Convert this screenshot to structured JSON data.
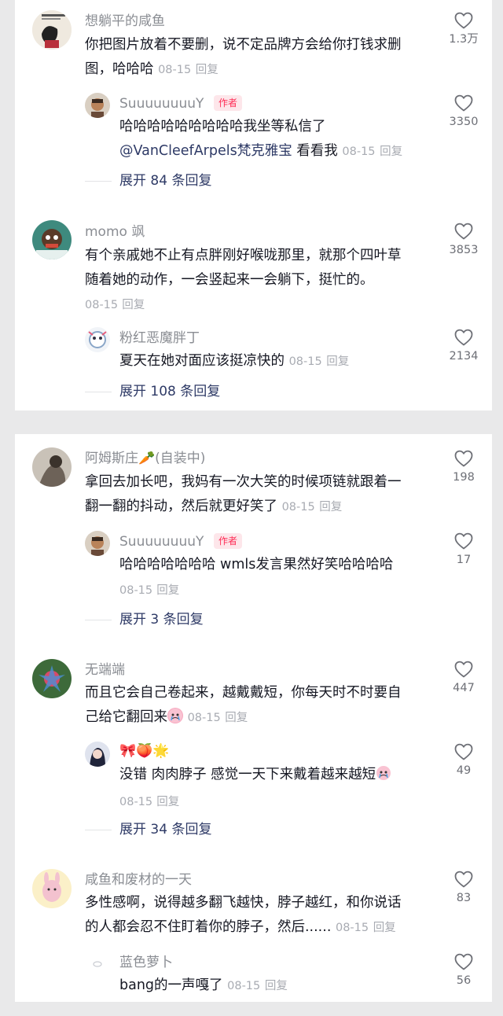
{
  "colors": {
    "author_tag": "#fe2c55",
    "link": "#2e3a66",
    "meta": "#a8abb2",
    "username": "#8a8d93",
    "body_text": "#161823"
  },
  "comments": [
    {
      "username": "想躺平的咸鱼",
      "text_lines": [
        "你把图片放着不要删，说不定品牌方会给你打钱求删",
        "图，哈哈哈"
      ],
      "date": "08-15",
      "reply_label": "回复",
      "likes": "1.3万",
      "replies": [
        {
          "username": "SuuuuuuuuY",
          "author_tag": "作者",
          "text_line1": "哈哈哈哈哈哈哈哈哈我坐等私信了",
          "mention": "@VanCleefArpels梵克雅宝",
          "text_line2_rest": " 看看我",
          "date": "08-15",
          "reply_label": "回复",
          "likes": "3350"
        }
      ],
      "expand_label": "展开 84 条回复"
    },
    {
      "username": "momo 飒",
      "text_lines": [
        "有个亲戚她不止有点胖刚好喉咙那里，就那个四叶草",
        "随着她的动作，一会竖起来一会躺下，挺忙的。"
      ],
      "date": "08-15",
      "reply_label": "回复",
      "likes": "3853",
      "replies": [
        {
          "username": "粉红恶魔胖丁",
          "text": "夏天在她对面应该挺凉快的",
          "date": "08-15",
          "reply_label": "回复",
          "likes": "2134"
        }
      ],
      "expand_label": "展开 108 条回复"
    },
    {
      "username": "阿姆斯庄🥕(自装中)",
      "text_lines": [
        "拿回去加长吧，我妈有一次大笑的时候项链就跟着一",
        "翻一翻的抖动，然后就更好笑了"
      ],
      "date": "08-15",
      "reply_label": "回复",
      "likes": "198",
      "replies": [
        {
          "username": "SuuuuuuuuY",
          "author_tag": "作者",
          "text": "哈哈哈哈哈哈哈 wmls发言果然好笑哈哈哈哈",
          "date": "08-15",
          "reply_label": "回复",
          "likes": "17"
        }
      ],
      "expand_label": "展开 3 条回复"
    },
    {
      "username": "无端端",
      "text_lines": [
        "而且它会自己卷起来，越戴戴短，你每天时不时要自",
        "己给它翻回来"
      ],
      "date": "08-15",
      "reply_label": "回复",
      "likes": "447",
      "replies": [
        {
          "username": "🎀🍑🌟",
          "text": "没错 肉肉脖子 感觉一天下来戴着越来越短",
          "date": "08-15",
          "reply_label": "回复",
          "likes": "49"
        }
      ],
      "expand_label": "展开 34 条回复"
    },
    {
      "username": "咸鱼和废材的一天",
      "text_lines": [
        "多性感啊，说得越多翻飞越快，脖子越红，和你说话",
        "的人都会忍不住盯着你的脖子，然后......"
      ],
      "date": "08-15",
      "reply_label": "回复",
      "likes": "83",
      "replies": [
        {
          "username": "蓝色萝卜",
          "text": "bang的一声嘎了",
          "date": "08-15",
          "reply_label": "回复",
          "likes": "56"
        }
      ]
    }
  ],
  "icons": {
    "like": "heart-outline-icon",
    "cry_emoji": "crying-face-emoji-icon"
  }
}
